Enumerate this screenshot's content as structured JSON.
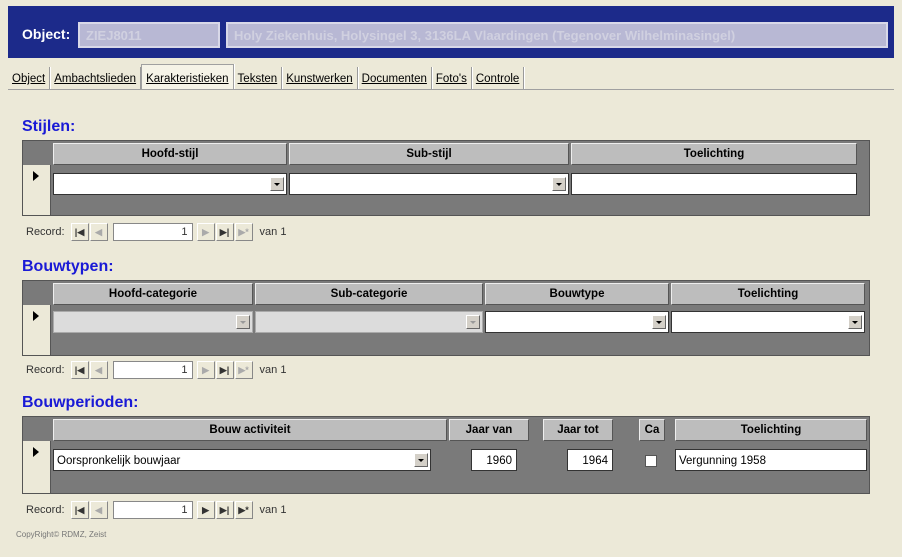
{
  "header": {
    "object_label": "Object:",
    "object_id": "ZIEJ8011",
    "object_address": "Holy Ziekenhuis, Holysingel 3, 3136LA Vlaardingen (Tegenover Wilhelminasingel)"
  },
  "tabs": [
    {
      "label": "Object",
      "active": false
    },
    {
      "label": "Ambachtslieden",
      "active": false
    },
    {
      "label": "Karakteristieken",
      "active": true
    },
    {
      "label": "Teksten",
      "active": false
    },
    {
      "label": "Kunstwerken",
      "active": false
    },
    {
      "label": "Documenten",
      "active": false
    },
    {
      "label": "Foto's",
      "active": false
    },
    {
      "label": "Controle",
      "active": false
    }
  ],
  "stijlen": {
    "title": "Stijlen:",
    "columns": [
      "Hoofd-stijl",
      "Sub-stijl",
      "Toelichting"
    ],
    "row": {
      "hoofd_stijl": "",
      "sub_stijl": "",
      "toelichting": ""
    },
    "nav": {
      "label": "Record:",
      "current": "1",
      "of_label": "van 1"
    }
  },
  "bouwtypen": {
    "title": "Bouwtypen:",
    "columns": [
      "Hoofd-categorie",
      "Sub-categorie",
      "Bouwtype",
      "Toelichting"
    ],
    "row": {
      "hoofd_categorie": "",
      "sub_categorie": "",
      "bouwtype": "",
      "toelichting": ""
    },
    "nav": {
      "label": "Record:",
      "current": "1",
      "of_label": "van 1"
    }
  },
  "bouwperioden": {
    "title": "Bouwperioden:",
    "columns": [
      "Bouw activiteit",
      "Jaar van",
      "Jaar tot",
      "Ca",
      "Toelichting"
    ],
    "row": {
      "bouw_activiteit": "Oorspronkelijk bouwjaar",
      "jaar_van": "1960",
      "jaar_tot": "1964",
      "ca": false,
      "toelichting": "Vergunning 1958"
    },
    "nav": {
      "label": "Record:",
      "current": "1",
      "of_label": "van 1"
    }
  },
  "footer": {
    "copyright": "CopyRight© RDMZ, Zeist"
  },
  "colors": {
    "header_bg": "#1c2a8a",
    "section_title": "#1a1ad6",
    "window_bg": "#ece9d8"
  },
  "icons": {
    "record_selector": "right-triangle",
    "dropdown": "down-triangle",
    "nav_first": "first-record",
    "nav_prev": "prev-record",
    "nav_next": "next-record",
    "nav_last": "last-record",
    "nav_new": "new-record"
  }
}
